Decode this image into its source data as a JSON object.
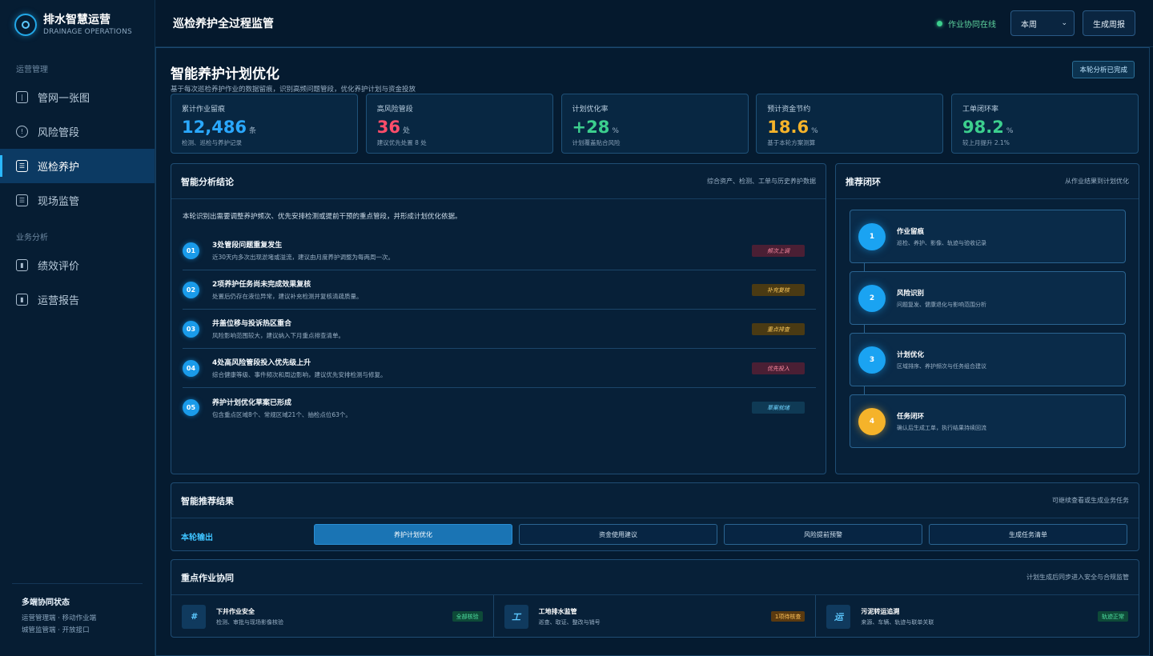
{
  "brand": {
    "title": "排水智慧运营",
    "subtitle": "DRAINAGE OPERATIONS"
  },
  "sidebar": {
    "sections": [
      {
        "label": "运营管理",
        "items": [
          {
            "label": "管网一张图",
            "icon": "map-icon"
          },
          {
            "label": "风险管段",
            "icon": "alert-icon"
          },
          {
            "label": "巡检养护",
            "icon": "inspection-icon",
            "active": true
          },
          {
            "label": "现场监管",
            "icon": "monitor-icon"
          }
        ]
      },
      {
        "label": "业务分析",
        "items": [
          {
            "label": "绩效评价",
            "icon": "chart-icon"
          },
          {
            "label": "运营报告",
            "icon": "report-icon"
          }
        ]
      }
    ],
    "footer": {
      "title": "多端协同状态",
      "line1": "运营管理端 · 移动作业端",
      "line2": "城管监管端 · 开放接口"
    }
  },
  "header": {
    "title": "巡检养护全过程监管",
    "status": "作业协同在线",
    "period": "本周",
    "report_button": "生成周报"
  },
  "hero": {
    "title": "智能养护计划优化",
    "subtitle": "基于每次巡检养护作业的数据留痕，识别高频问题管段，优化养护计划与资金投放",
    "badge": "本轮分析已完成"
  },
  "kpis": [
    {
      "label": "累计作业留痕",
      "value": "12,486",
      "unit": "条",
      "note": "检测、巡检与养护记录",
      "color": "#2aa8ff"
    },
    {
      "label": "高风险管段",
      "value": "36",
      "unit": "处",
      "note": "建议优先处置 8 处",
      "color": "#ff4d6a"
    },
    {
      "label": "计划优化率",
      "value": "+28",
      "unit": "%",
      "note": "计划覆盖贴合风险",
      "color": "#3ccf8e"
    },
    {
      "label": "预计资金节约",
      "value": "18.6",
      "unit": "%",
      "note": "基于本轮方案测算",
      "color": "#f5b32a"
    },
    {
      "label": "工单闭环率",
      "value": "98.2",
      "unit": "%",
      "note": "较上月提升 2.1%",
      "color": "#3ccf8e"
    }
  ],
  "analysis": {
    "title": "智能分析结论",
    "subtitle": "综合资产、检测、工单与历史养护数据",
    "intro": "本轮识别出需要调整养护频次、优先安排检测或提前干预的重点管段，并形成计划优化依据。",
    "items": [
      {
        "no": "01",
        "title": "3处管段问题重复发生",
        "desc": "近30天内多次出现淤堵或溢流，建议由月度养护调整为每两周一次。",
        "tag": "频次上调",
        "tone": "red"
      },
      {
        "no": "02",
        "title": "2项养护任务尚未完成效果复核",
        "desc": "处置后仍存在液位异常，建议补充检测并复核清疏质量。",
        "tag": "补充复核",
        "tone": "amber"
      },
      {
        "no": "03",
        "title": "井盖位移与投诉热区重合",
        "desc": "风险影响范围较大，建议纳入下月重点排查清单。",
        "tag": "重点排查",
        "tone": "amber"
      },
      {
        "no": "04",
        "title": "4处高风险管段投入优先级上升",
        "desc": "综合健康等级、事件频次和周边影响，建议优先安排检测与修复。",
        "tag": "优先投入",
        "tone": "red"
      },
      {
        "no": "05",
        "title": "养护计划优化草案已形成",
        "desc": "包含重点区域8个、常规区域21个、抽检点位63个。",
        "tag": "草案就绪",
        "tone": "cyan"
      }
    ]
  },
  "loop": {
    "title": "推荐闭环",
    "subtitle": "从作业结果到计划优化",
    "steps": [
      {
        "no": "1",
        "title": "作业留痕",
        "desc": "巡检、养护、影像、轨迹与验收记录"
      },
      {
        "no": "2",
        "title": "风险识别",
        "desc": "问题复发、健康退化与影响范围分析"
      },
      {
        "no": "3",
        "title": "计划优化",
        "desc": "区域排序、养护频次与任务组合建议"
      },
      {
        "no": "4",
        "title": "任务闭环",
        "desc": "确认后生成工单，执行结果持续回流"
      }
    ]
  },
  "recommend": {
    "title": "智能推荐结果",
    "subtitle": "可继续查看或生成业务任务",
    "label": "本轮输出",
    "buttons": [
      "养护计划优化",
      "资金使用建议",
      "风险提前预警",
      "生成任务清单"
    ]
  },
  "coop": {
    "title": "重点作业协同",
    "subtitle": "计划生成后同步进入安全与合规监管",
    "cards": [
      {
        "icon": "#",
        "title": "下井作业安全",
        "desc": "检测、审批与现场影像核验",
        "badge": "全部核验",
        "tone": "green"
      },
      {
        "icon": "工",
        "title": "工地排水监管",
        "desc": "巡查、取证、整改与销号",
        "badge": "1项待核查",
        "tone": "orange"
      },
      {
        "icon": "运",
        "title": "污泥转运追溯",
        "desc": "来源、车辆、轨迹与联单关联",
        "badge": "轨迹正常",
        "tone": "green"
      }
    ]
  }
}
